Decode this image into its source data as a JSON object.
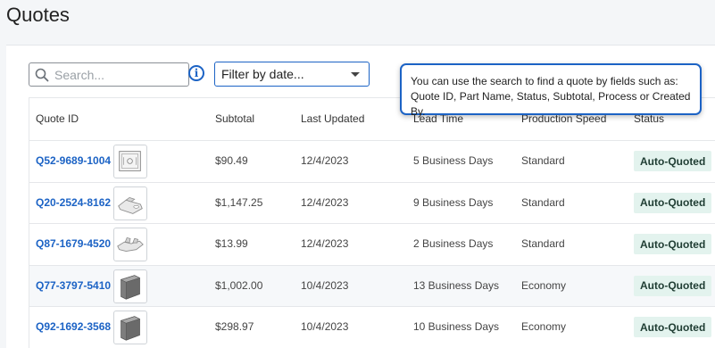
{
  "page": {
    "title": "Quotes"
  },
  "toolbar": {
    "search_placeholder": "Search...",
    "date_filter_label": "Filter by date..."
  },
  "tooltip": {
    "line1": "You can use the search to find a quote by fields such as:",
    "line2": "Quote ID, Part Name, Status, Subtotal, Process or Created By."
  },
  "table": {
    "headers": {
      "quote_id": "Quote ID",
      "subtotal": "Subtotal",
      "last_updated": "Last Updated",
      "lead_time": "Lead Time",
      "production_speed": "Production Speed",
      "status": "Status"
    },
    "rows": [
      {
        "quote_id": "Q52-9689-1004",
        "subtotal": "$90.49",
        "last_updated": "12/4/2023",
        "lead_time": "5 Business Days",
        "production_speed": "Standard",
        "status": "Auto-Quoted",
        "thumb": "flat-plate-icon"
      },
      {
        "quote_id": "Q20-2524-8162",
        "subtotal": "$1,147.25",
        "last_updated": "12/4/2023",
        "lead_time": "9 Business Days",
        "production_speed": "Standard",
        "status": "Auto-Quoted",
        "thumb": "bracket-part-icon"
      },
      {
        "quote_id": "Q87-1679-4520",
        "subtotal": "$13.99",
        "last_updated": "12/4/2023",
        "lead_time": "2 Business Days",
        "production_speed": "Standard",
        "status": "Auto-Quoted",
        "thumb": "clip-part-icon"
      },
      {
        "quote_id": "Q77-3797-5410",
        "subtotal": "$1,002.00",
        "last_updated": "10/4/2023",
        "lead_time": "13 Business Days",
        "production_speed": "Economy",
        "status": "Auto-Quoted",
        "thumb": "block-part-icon"
      },
      {
        "quote_id": "Q92-1692-3568",
        "subtotal": "$298.97",
        "last_updated": "10/4/2023",
        "lead_time": "10 Business Days",
        "production_speed": "Economy",
        "status": "Auto-Quoted",
        "thumb": "block-part-icon"
      }
    ]
  },
  "colors": {
    "accent": "#1c63c5",
    "badge_bg": "#e3f3ee"
  }
}
